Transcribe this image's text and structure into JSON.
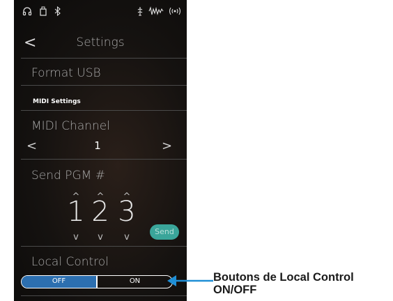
{
  "statusbar": {
    "left_icons": [
      "headphones-icon",
      "usb-memory-icon",
      "bluetooth-icon"
    ],
    "right_icons": [
      "metronome-icon",
      "waveform-icon",
      "wireless-icon"
    ]
  },
  "header": {
    "back_glyph": "<",
    "title": "Settings"
  },
  "format_usb": {
    "label": "Format USB"
  },
  "midi": {
    "section_title": "MIDI Settings",
    "channel_label": "MIDI Channel",
    "channel_value": "1",
    "prev_glyph": "<",
    "next_glyph": ">"
  },
  "send_pgm": {
    "label": "Send PGM #",
    "digits": [
      "1",
      "2",
      "3"
    ],
    "up_glyph": "^",
    "down_glyph": "v",
    "send_label": "Send"
  },
  "local_control": {
    "label": "Local Control",
    "off_label": "OFF",
    "on_label": "ON",
    "state": "OFF"
  },
  "annotation": {
    "line1": "Boutons de Local Control",
    "line2": "ON/OFF"
  },
  "colors": {
    "accent_blue": "#2c6fb0",
    "send_teal": "#3aa59a",
    "callout_blue": "#1f8fd6"
  }
}
